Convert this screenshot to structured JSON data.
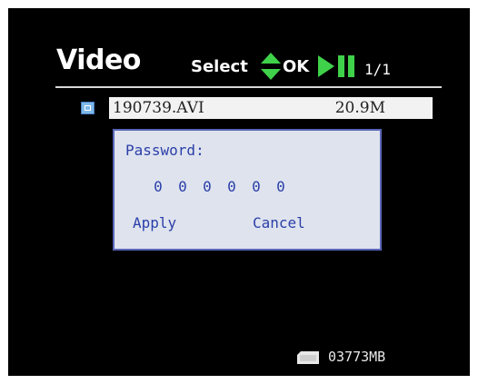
{
  "header": {
    "title": "Video",
    "select_label": "Select",
    "ok_label": "OK",
    "page_count": "1/1"
  },
  "file": {
    "name": "190739.AVI",
    "size": "20.9M"
  },
  "dialog": {
    "password_label": "Password:",
    "digits": [
      "0",
      "0",
      "0",
      "0",
      "0",
      "0"
    ],
    "apply_label": "Apply",
    "cancel_label": "Cancel"
  },
  "footer": {
    "storage": "03773MB"
  },
  "colors": {
    "screen": "#000000",
    "accent_green": "#3fd14a",
    "dialog_bg": "#dfe3ee",
    "dialog_border": "#5866b8",
    "dialog_text": "#2a3fa8"
  },
  "icons": {
    "updown": "updown-arrows-icon",
    "playpause": "play-pause-icon",
    "file": "video-file-icon",
    "storage": "sd-card-icon"
  }
}
